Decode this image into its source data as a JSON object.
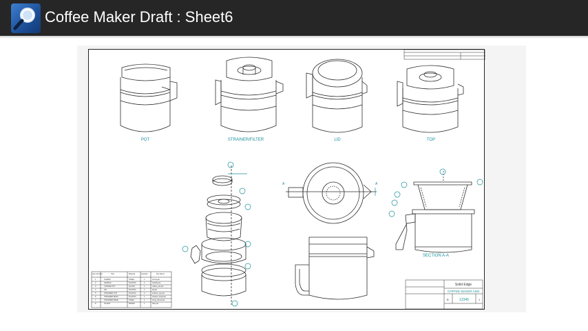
{
  "app": {
    "title": "Coffee Maker Draft : Sheet6",
    "icon": "magnifier-icon"
  },
  "drawing": {
    "view_labels": {
      "pot": "POT",
      "strainer": "STRAINER/FILTER",
      "lid": "LID",
      "top": "TOP",
      "section": "SECTION A-A"
    },
    "section_markers": [
      "A",
      "A"
    ],
    "callout_numbers": [
      "1",
      "2",
      "3",
      "4",
      "5",
      "6",
      "7",
      "8"
    ],
    "bom": {
      "headers": [
        "Item Number",
        "Title",
        "Material",
        "Quantity",
        "File Name"
      ],
      "rows": [
        [
          "1",
          "SCREW",
          "STEEL",
          "1",
          "screw.par"
        ],
        [
          "2",
          "HANDLE",
          "PLASTIC",
          "1",
          "handle.par"
        ],
        [
          "3",
          "COFFEE POT",
          "GLASS",
          "1",
          "coffee_pot.par"
        ],
        [
          "4",
          "LID",
          "PLASTIC",
          "1",
          "lid.par"
        ],
        [
          "5",
          "STRAINER TOP",
          "PLASTIC",
          "2",
          "strainer_top.par"
        ],
        [
          "6",
          "STRAINER BODY",
          "PLASTIC",
          "1",
          "strainer_body.par"
        ],
        [
          "7",
          "STRAINER BASE",
          "STEEL",
          "1",
          "strng_frame.par"
        ],
        [
          "8",
          "FILTER",
          "PAPER",
          "1",
          "filter.par"
        ]
      ]
    },
    "title_block": {
      "company": "Solid Edge",
      "title": "COFFEE MAKER ASM",
      "size": "B",
      "dwg_no": "12345",
      "rev": "1"
    }
  },
  "colors": {
    "titlebar": "#262626",
    "drawing_line": "#2b2b2b",
    "annotation": "#1a8f9a"
  }
}
